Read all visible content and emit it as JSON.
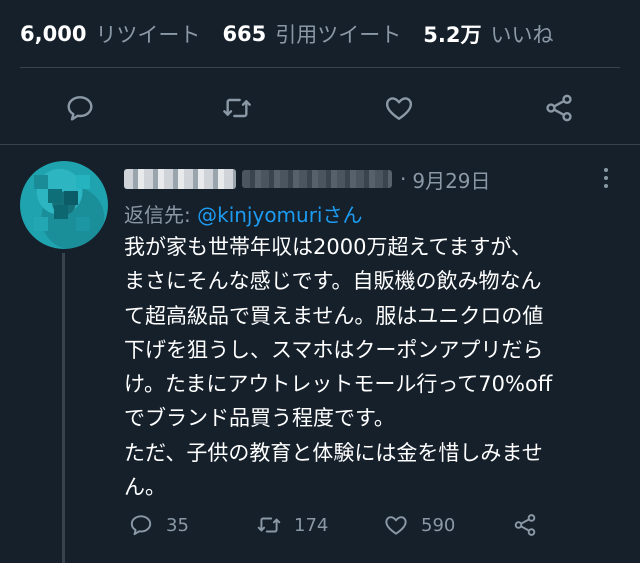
{
  "stats": [
    {
      "count": "6,000",
      "label": "リツイート"
    },
    {
      "count": "665",
      "label": "引用ツイート"
    },
    {
      "count": "5.2万",
      "label": "いいね"
    }
  ],
  "main_actions": [
    "reply-icon",
    "retweet-icon",
    "like-icon",
    "share-icon"
  ],
  "reply": {
    "date": "9月29日",
    "reply_to_prefix": "返信先: ",
    "reply_to_handle": "@kinjyomuri",
    "reply_to_suffix": "さん",
    "text": "我が家も世帯年収は2000万超えてますが、\nまさにそんな感じです。自販機の飲み物なん\nて超高級品で買えません。服はユニクロの値\n下げを狙うし、スマホはクーポンアプリだら\nけ。たまにアウトレットモール行って70%off\nでブランド品買う程度です。\nただ、子供の教育と体験には金を惜しみませ\nん。",
    "reply_count": "35",
    "retweet_count": "174",
    "like_count": "590"
  },
  "colors": {
    "background": "#15202b",
    "secondary_text": "#8b98a5",
    "link": "#1d9bf0",
    "divider": "#38444d"
  }
}
